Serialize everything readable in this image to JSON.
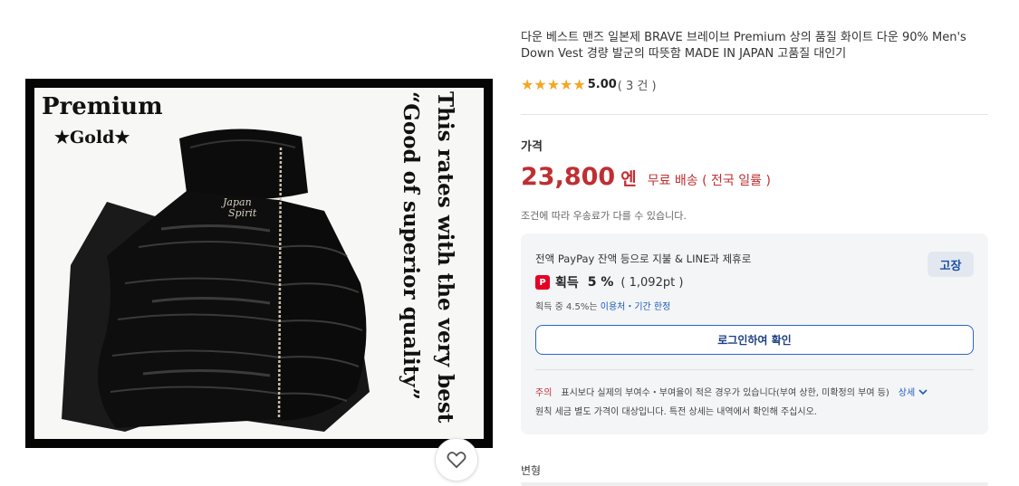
{
  "image": {
    "brand": "Premium",
    "grade": "★Gold★",
    "embroidery": "Japan\nSpirit",
    "slogan_line1": "This rates with the very best",
    "slogan_line2": "“Good of superior quality”"
  },
  "product": {
    "title": "다운 베스트 맨즈 일본제 BRAVE 브레이브 Premium 상의 품질 화이트 다운 90% Men's Down Vest 경량 발군의 따뜻함 MADE IN JAPAN 고품질 대인기",
    "stars": "★★★★★",
    "rating": "5.00",
    "review_count": "( 3 건 )"
  },
  "price": {
    "label": "가격",
    "amount": "23,800",
    "unit": "엔",
    "shipping": "무료 배송 ( 전국 일률 )",
    "shipping_note": "조건에 따라 우송료가 다를 수 있습니다."
  },
  "points": {
    "headline": "전액 PayPay 잔액 등으로 지불 & LINE과 제휴로",
    "change_button": "고장",
    "icon_text": "P",
    "earn_label": "획득",
    "earn_pct": "5 %",
    "earn_pt": "( 1,092pt )",
    "sub_prefix": "획득 중 4.5%는 ",
    "sub_link": "이용처・기간 한정",
    "login_button": "로그인하여 확인",
    "note_label": "주의",
    "note_text": "표시보다 실제의 부여수・부여율이 적은 경우가 있습니다(부여 상한, 미확정의 부여 등)",
    "note_link": "상세",
    "note_text2": "원칙 세금 별도 가격이 대상입니다. 특전 상세는 내역에서 확인해 주십시오."
  },
  "variant": {
    "label": "변형"
  },
  "colors": {
    "price_red": "#bf2f32",
    "star_gold": "#f5a623",
    "link_blue": "#1a5bbf",
    "paypay_red": "#e60023"
  }
}
